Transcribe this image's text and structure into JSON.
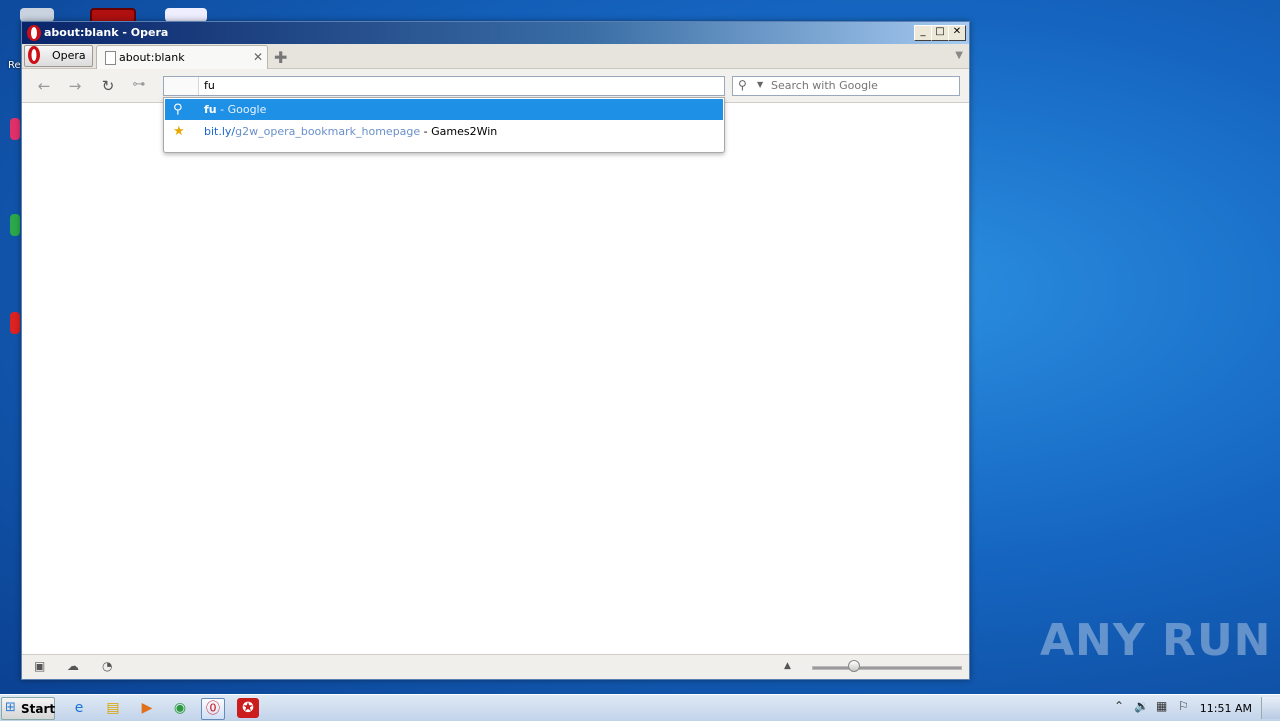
{
  "window": {
    "title": "about:blank - Opera",
    "controls": {
      "minimize": "_",
      "maximize": "□",
      "close": "✕"
    }
  },
  "tabs": {
    "menu_label": "Opera",
    "items": [
      {
        "title": "about:blank",
        "close": "✕"
      }
    ],
    "new_tab": "✚"
  },
  "toolbar": {
    "address_value": "fu",
    "search_placeholder": "Search with Google"
  },
  "dropdown": {
    "items": [
      {
        "query": "fu",
        "source": " - Google"
      },
      {
        "url_host": "bit.ly/",
        "url_path": "g2w_opera_bookmark_homepage",
        "title": " - Games2Win"
      }
    ]
  },
  "desktop": {
    "label_partial": "Re"
  },
  "watermark": "ANY RUN",
  "taskbar": {
    "start_label": "Start",
    "clock": "11:51 AM"
  },
  "colors": {
    "selection": "#1e90e6",
    "title_bar": "#0a246a",
    "opera_red": "#cc0f16"
  }
}
